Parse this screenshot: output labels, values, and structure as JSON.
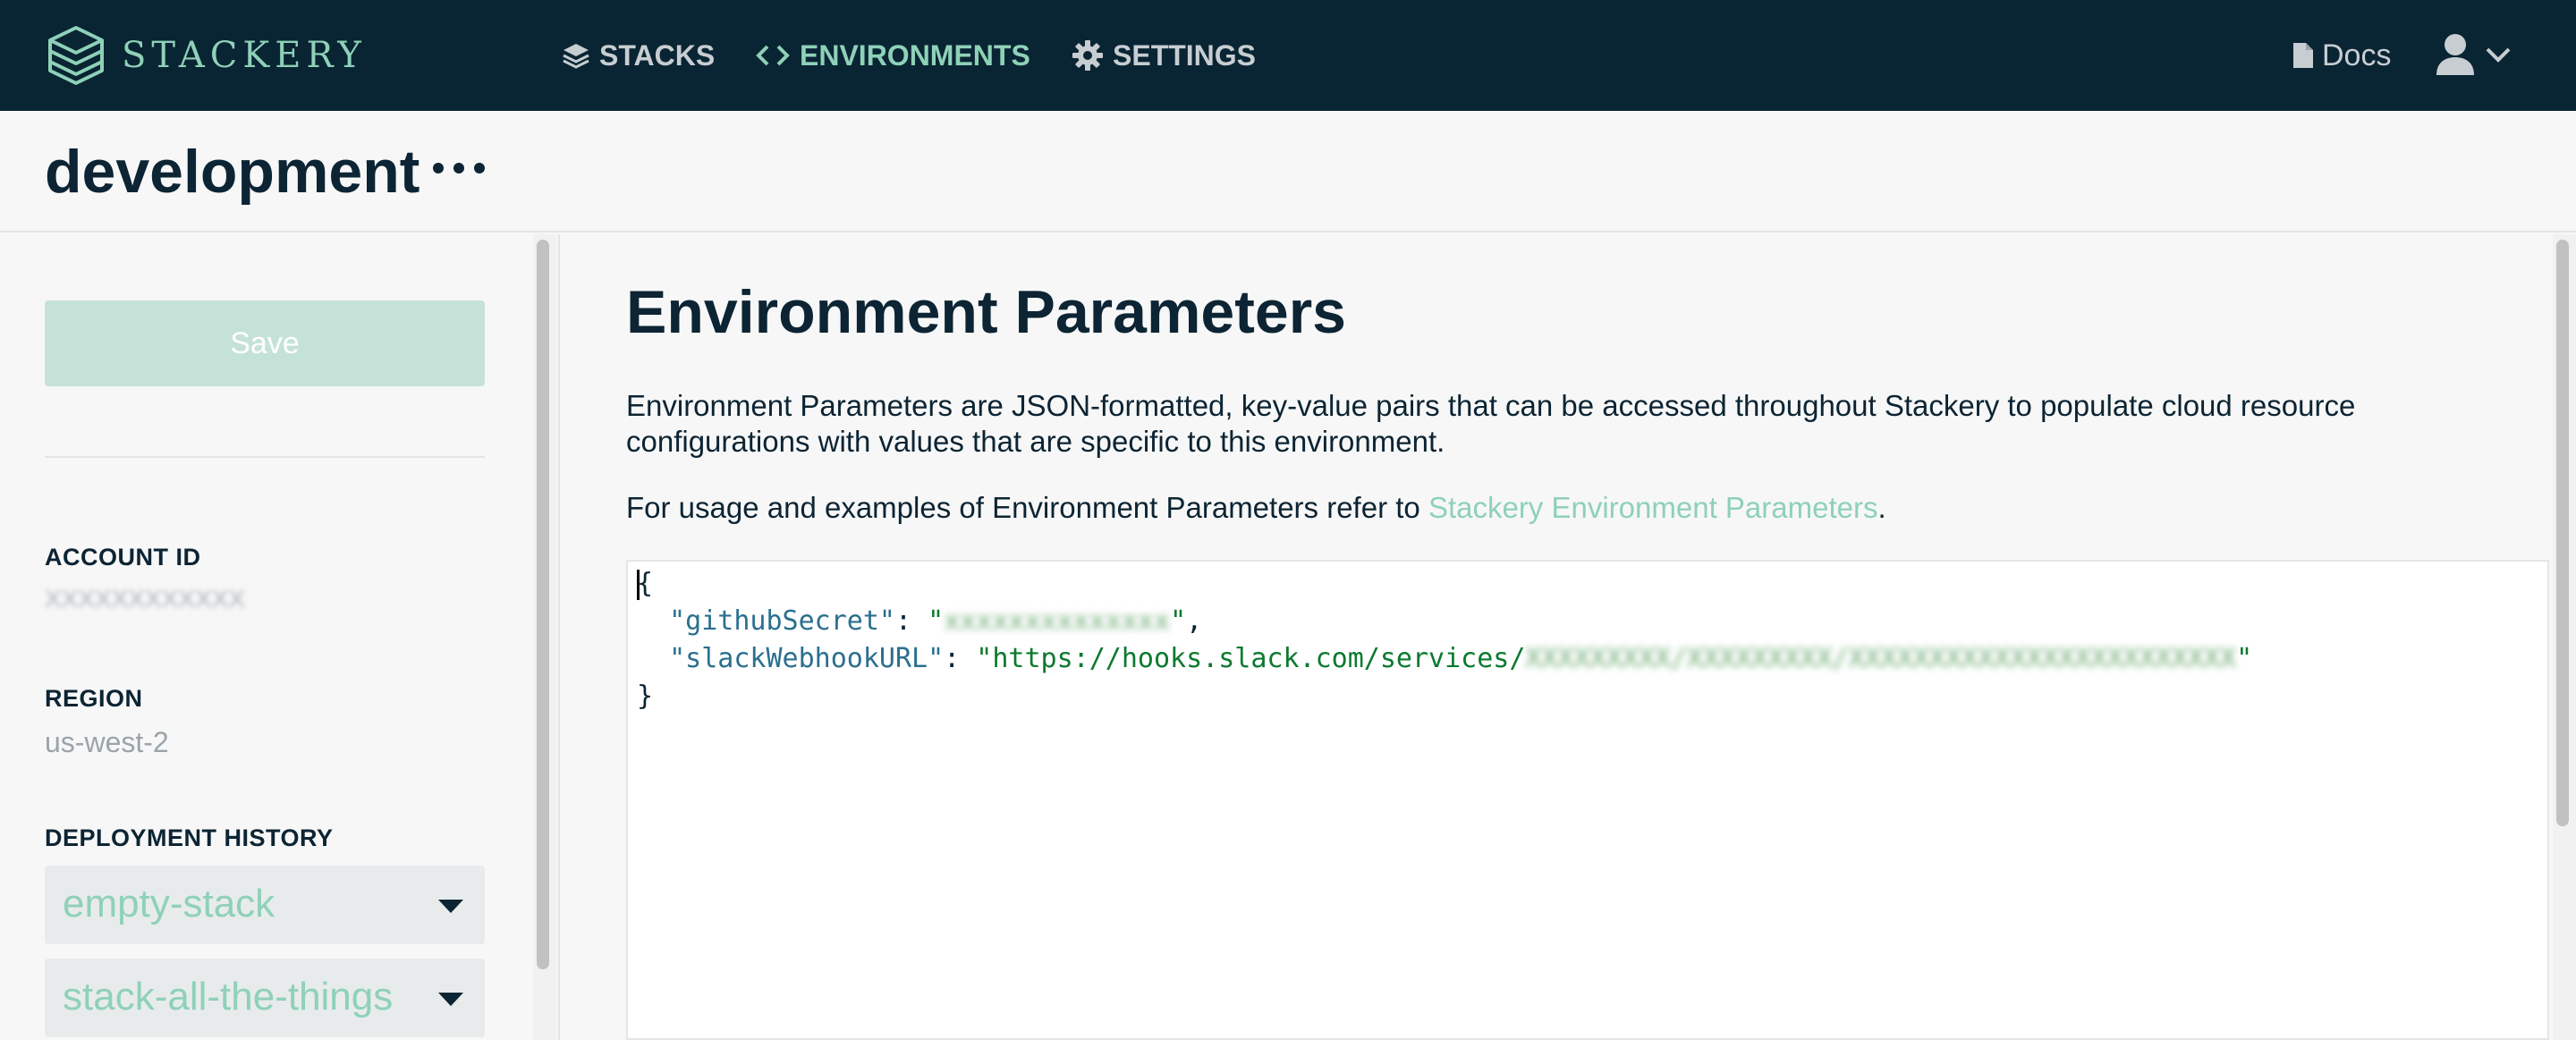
{
  "app": {
    "brand_name": "STACKERY",
    "brand_icon": "stackery-logo",
    "colors": {
      "nav_bg": "#092433",
      "accent": "#8ed1b8",
      "text_dark": "#0c2433",
      "muted": "#9aa4aa",
      "save_disabled": "#c5e2d9"
    }
  },
  "nav": {
    "items": [
      {
        "label": "STACKS",
        "icon": "layers-icon",
        "active": false
      },
      {
        "label": "ENVIRONMENTS",
        "icon": "code-brackets-icon",
        "active": true
      },
      {
        "label": "SETTINGS",
        "icon": "gear-icon",
        "active": false
      }
    ],
    "docs_label": "Docs",
    "docs_icon": "document-icon",
    "user_icon": "user-icon",
    "user_menu_icon": "chevron-down-icon"
  },
  "page": {
    "title": "development",
    "more_icon": "ellipsis-icon"
  },
  "sidebar": {
    "save_label": "Save",
    "account_id_label": "ACCOUNT ID",
    "account_id_value": "XXXXXXXXXXXX",
    "region_label": "REGION",
    "region_value": "us-west-2",
    "deployment_history_label": "DEPLOYMENT HISTORY",
    "history": [
      {
        "label": "empty-stack"
      },
      {
        "label": "stack-all-the-things"
      }
    ]
  },
  "main": {
    "title": "Environment Parameters",
    "description": "Environment Parameters are JSON-formatted, key-value pairs that can be accessed throughout Stackery to populate cloud resource configurations with values that are specific to this environment.",
    "usage_prefix": "For usage and examples of Environment Parameters refer to ",
    "usage_link": "Stackery Environment Parameters",
    "usage_suffix": ".",
    "editor": {
      "open_brace": "{",
      "close_brace": "}",
      "params": [
        {
          "key": "\"githubSecret\"",
          "value_prefix": "\"",
          "value_hidden": "xxxxxxxxxxxxxx",
          "value_suffix": "\"",
          "trailing": ","
        },
        {
          "key": "\"slackWebhookURL\"",
          "value_prefix": "\"https://hooks.slack.com/services/",
          "value_hidden": "XXXXXXXXX/XXXXXXXXX/XXXXXXXXXXXXXXXXXXXXXXXX",
          "value_suffix": "\"",
          "trailing": ""
        }
      ]
    }
  }
}
